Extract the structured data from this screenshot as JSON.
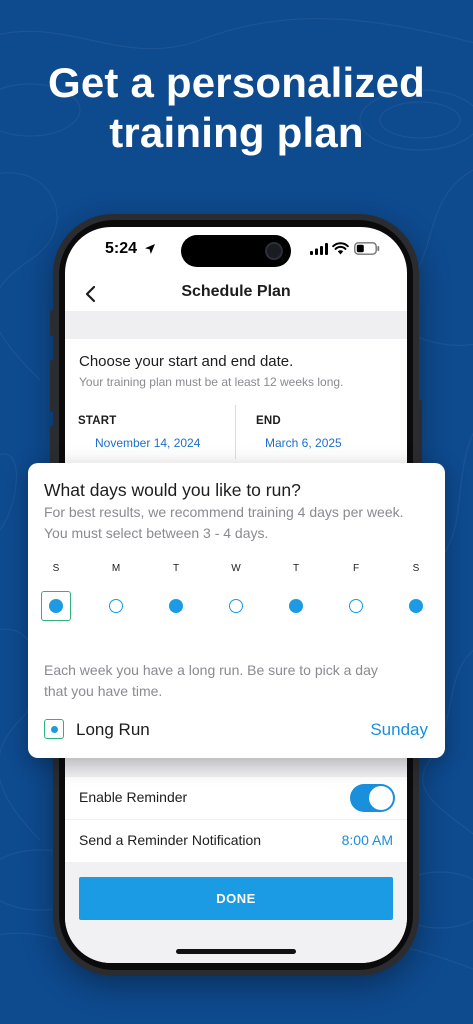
{
  "colors": {
    "background": "#0e4a8e",
    "accent": "#1a9be3",
    "link": "#1f6fc9",
    "focus": "#2fb37a"
  },
  "headline": {
    "line1": "Get a personalized",
    "line2": "training plan"
  },
  "status_bar": {
    "time": "5:24",
    "icons": [
      "location-arrow-icon",
      "cellular-signal-icon",
      "wifi-icon",
      "battery-icon"
    ]
  },
  "nav": {
    "back_icon": "chevron-left-icon",
    "title": "Schedule Plan"
  },
  "date_section": {
    "question": "Choose your start and end date.",
    "subtitle": "Your training plan must be at least 12 weeks long.",
    "start_label": "START",
    "start_value": "November 14, 2024",
    "end_label": "END",
    "end_value": "March 6, 2025"
  },
  "days_card": {
    "title": "What days would you like to run?",
    "description": "For best results, we recommend training 4 days per week. You must select between 3 - 4 days.",
    "days": [
      {
        "label": "S",
        "selected": true
      },
      {
        "label": "M",
        "selected": false
      },
      {
        "label": "T",
        "selected": true
      },
      {
        "label": "W",
        "selected": false
      },
      {
        "label": "T",
        "selected": true
      },
      {
        "label": "F",
        "selected": false
      },
      {
        "label": "S",
        "selected": true
      }
    ],
    "long_run_description": "Each week you have a long run. Be sure to pick a day that you have time.",
    "long_run_label": "Long Run",
    "long_run_value": "Sunday"
  },
  "reminder": {
    "enable_label": "Enable Reminder",
    "enabled": true,
    "notify_label": "Send a Reminder Notification",
    "notify_value": "8:00 AM"
  },
  "done_button": {
    "label": "DONE"
  }
}
